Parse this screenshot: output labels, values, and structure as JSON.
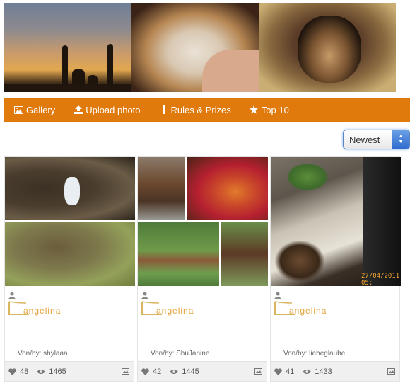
{
  "header": {
    "banner_images": [
      "silhouettes-sunset-photo",
      "cat-photo",
      "dog-photo"
    ]
  },
  "nav": {
    "items": [
      {
        "label": "Gallery",
        "icon": "picture-icon"
      },
      {
        "label": "Upload photo",
        "icon": "upload-icon"
      },
      {
        "label": "Rules & Prizes",
        "icon": "info-icon"
      },
      {
        "label": "Top 10",
        "icon": "star-icon"
      }
    ],
    "background": "#e07a0c"
  },
  "sort": {
    "selected": "Newest"
  },
  "cards": [
    {
      "username": "angelina",
      "byline": "Von/by: shylaaa",
      "likes": "48",
      "views": "1465"
    },
    {
      "username": "angelina",
      "byline": "Von/by: ShuJanine",
      "likes": "42",
      "views": "1445"
    },
    {
      "username": "angelina",
      "byline": "Von/by: liebeglaube",
      "likes": "41",
      "views": "1433",
      "photo_caption": "27/04/2011 05:"
    }
  ],
  "colors": {
    "accent": "#e07a0c",
    "username": "#e5a33a"
  }
}
